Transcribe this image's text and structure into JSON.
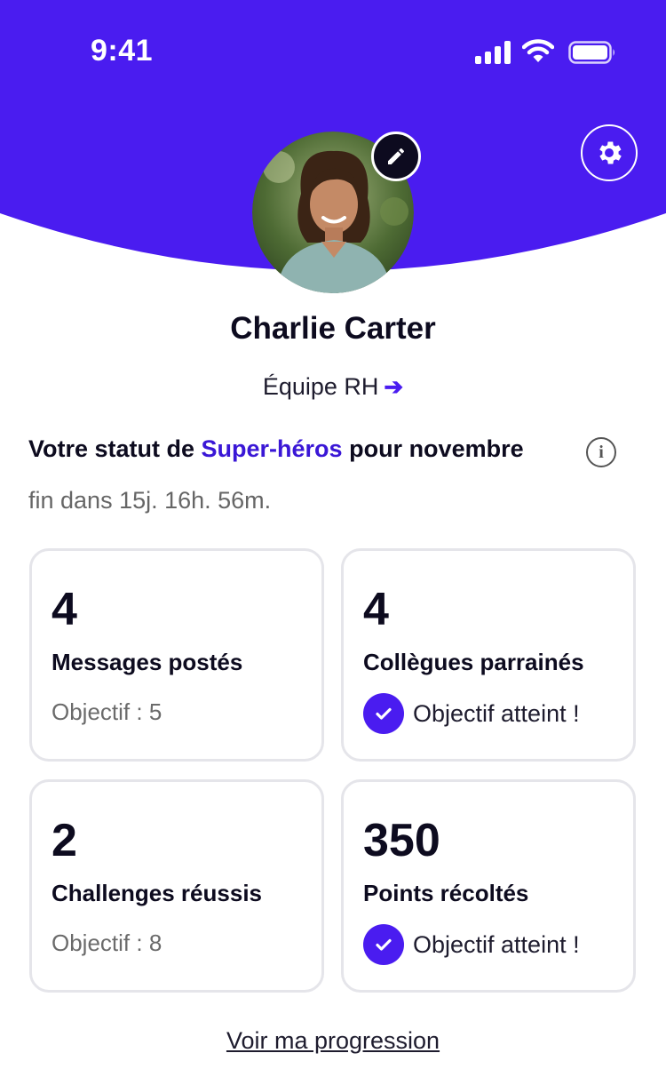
{
  "status_bar": {
    "time": "9:41"
  },
  "colors": {
    "primary": "#4a1cf0",
    "accent_text": "#3a17d6",
    "card_border": "#e5e5ea"
  },
  "profile": {
    "name": "Charlie Carter",
    "team": "Équipe RH",
    "team_arrow": "➔"
  },
  "status": {
    "prefix": "Votre statut de ",
    "level": "Super-héros",
    "suffix": " pour novembre",
    "countdown": "fin dans 15j. 16h. 56m."
  },
  "cards": [
    {
      "value": "4",
      "label": "Messages postés",
      "goal": "Objectif : 5"
    },
    {
      "value": "4",
      "label": "Collègues parrainés",
      "achieved": "Objectif atteint !"
    },
    {
      "value": "2",
      "label": "Challenges réussis",
      "goal": "Objectif : 8"
    },
    {
      "value": "350",
      "label": "Points récoltés",
      "achieved": "Objectif atteint !"
    }
  ],
  "footer": {
    "link": "Voir ma progression"
  },
  "icons": {
    "settings": "gear-icon",
    "edit": "pencil-icon",
    "info": "info-icon",
    "check": "check-icon"
  }
}
